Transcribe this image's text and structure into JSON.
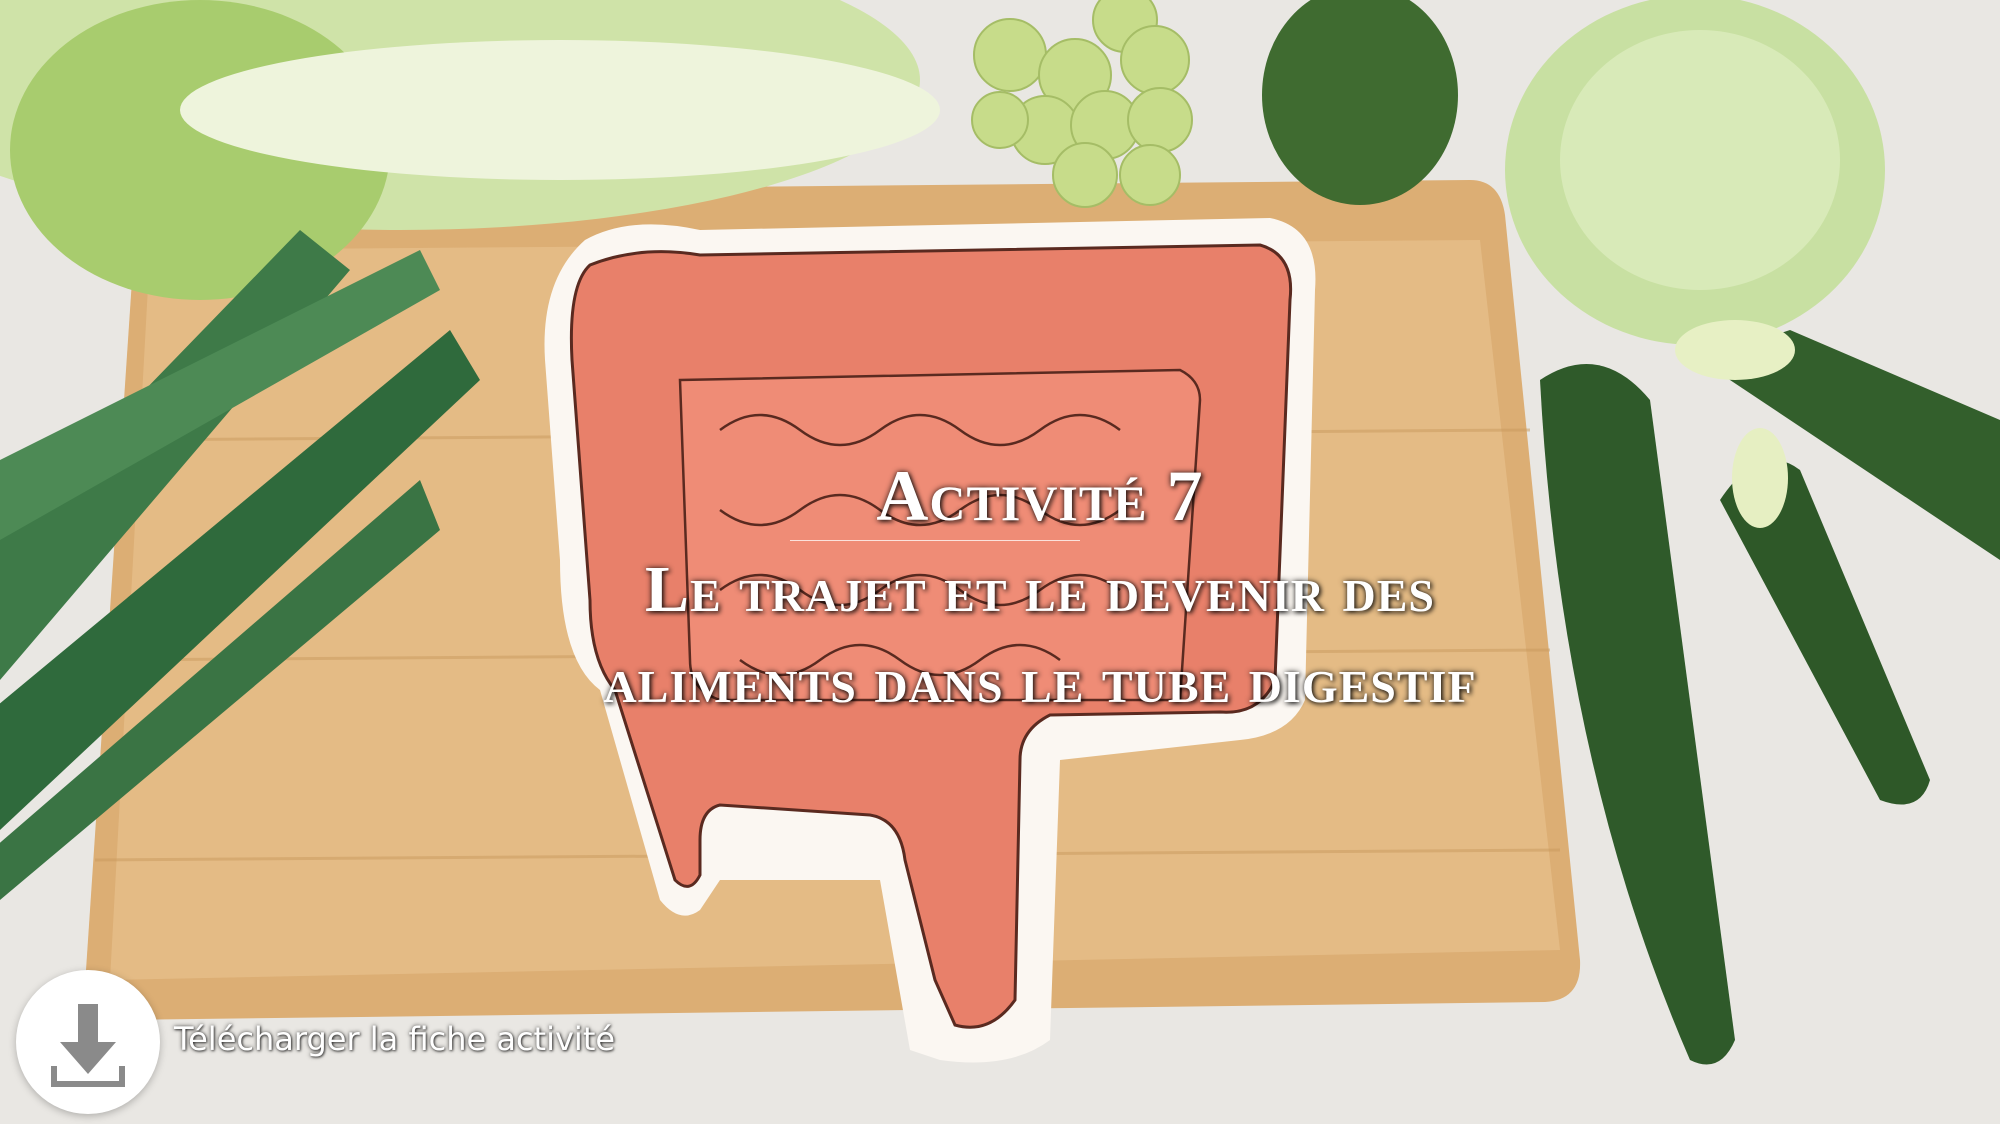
{
  "slide": {
    "title_line_1": "Activité 7",
    "title_line_2": "Le trajet et le devenir des",
    "title_line_3": "aliments dans le tube digestif"
  },
  "download": {
    "label": "Télécharger la fiche activité",
    "icon": "download-icon"
  },
  "colors": {
    "title_text": "#ffffff",
    "button_bg": "#ffffff",
    "icon_color": "#8a8a8a",
    "intestine": "#e8806a",
    "board": "#e6be8a",
    "counter": "#e8e6e2"
  }
}
